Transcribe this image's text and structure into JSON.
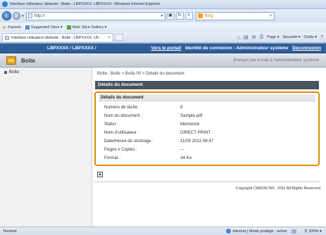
{
  "window": {
    "title": "Interface utilisateur distante : Boite : LBPXXXX: LBPXXXX- Windows Internet Explorer"
  },
  "address_bar": {
    "url": "http://",
    "search_engine": "Bing",
    "nav_buttons": [
      "back",
      "forward"
    ]
  },
  "favorites_bar": {
    "favorites_label": "Favoris",
    "items": [
      "Suggested Sites ▾",
      "Web Slice Gallery ▾"
    ]
  },
  "tab_bar": {
    "tab_title": "Interface utilisateur distante : Boite : LBPXXXX: LB...",
    "commands": [
      "Page ▾",
      "Sécurité ▾",
      "Outils ▾"
    ]
  },
  "page": {
    "device_name": "LBPXXXX / LBPXXXX /",
    "portal_link": "Vers le portail",
    "login_info": "Identité de connexion : Administrateur système",
    "logout_link": "Déconnexion",
    "header_title": "Boîte",
    "email_admin_link": "Envoyer par e-mail à l'administrateur système",
    "sidebar": {
      "items": [
        {
          "label": "Boîte"
        }
      ]
    },
    "breadcrumb": "Boîte : Boîte > Boîte 00 > Détails du document",
    "section_title": "Détails du document",
    "panel_title": "Détails du document",
    "details": [
      {
        "label": "Numéro de tâche :",
        "value": "6"
      },
      {
        "label": "Nom du document :",
        "value": "Sample.pdf"
      },
      {
        "label": "Statut :",
        "value": "Mémorisé"
      },
      {
        "label": "Nom d'utilisateur :",
        "value": "DIRECT PRINT"
      },
      {
        "label": "Date/Heure du stockage :",
        "value": "11/09 2011 06:47"
      },
      {
        "label": "Pages x Copies :",
        "value": "---"
      },
      {
        "label": "Format :",
        "value": "34 Ko"
      }
    ],
    "copyright": "Copyright CANON INC. 2011 All Rights Reserved"
  },
  "status_bar": {
    "status_text": "Terminé",
    "zone_text": "Internet | Mode protégé : activé",
    "zoom": "100%"
  }
}
